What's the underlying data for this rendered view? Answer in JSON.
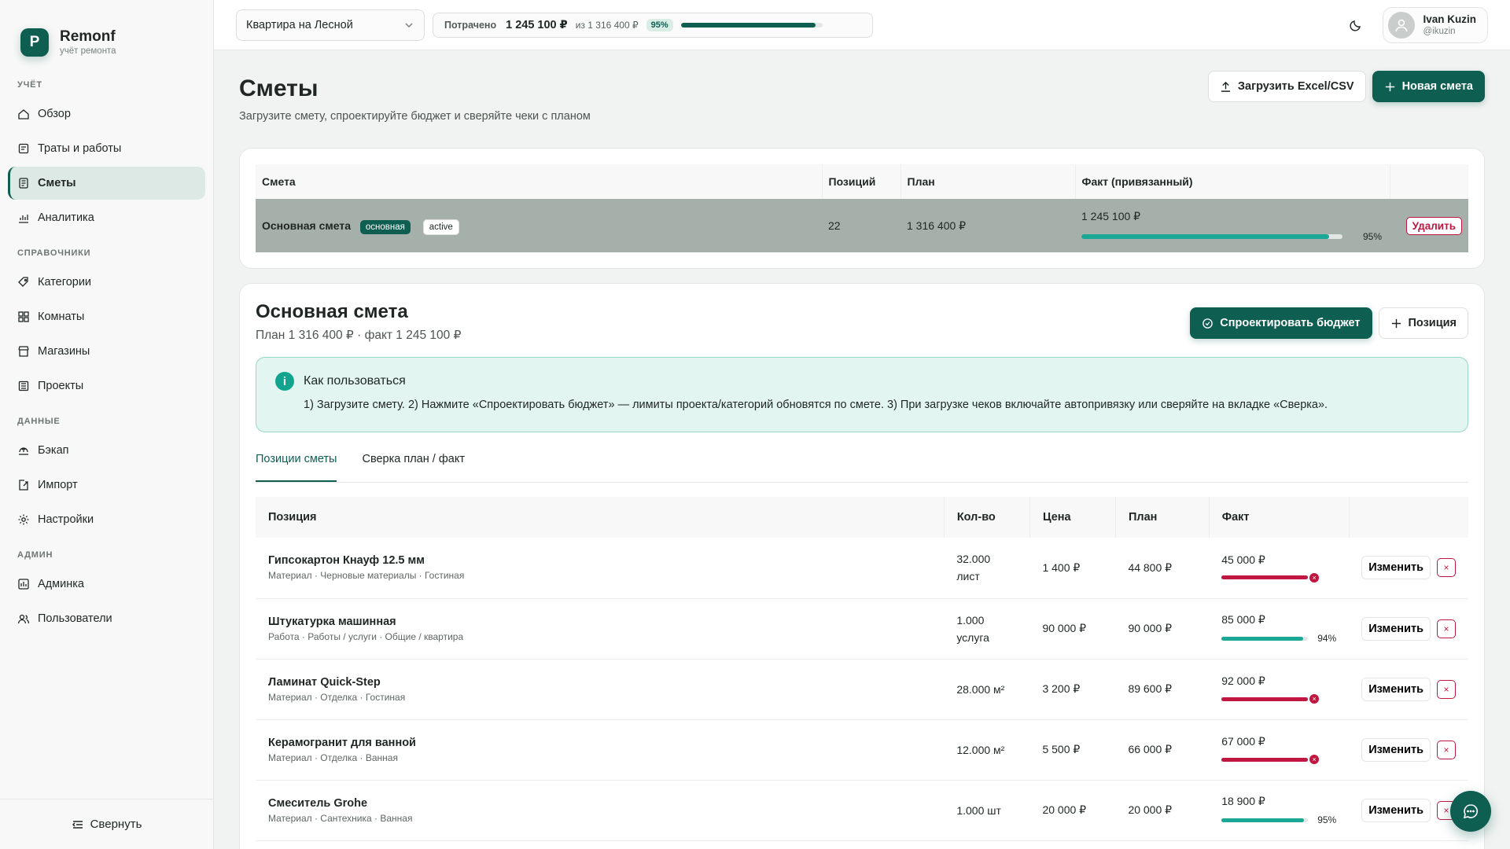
{
  "brand": {
    "letter": "P",
    "name": "Remonf",
    "subtitle": "учёт ремонта"
  },
  "sidebar": {
    "sections": [
      {
        "title": "Учёт",
        "items": [
          {
            "label": "Обзор",
            "icon": "home-icon"
          },
          {
            "label": "Траты и работы",
            "icon": "receipt-icon"
          },
          {
            "label": "Сметы",
            "icon": "estimate-icon",
            "active": true
          },
          {
            "label": "Аналитика",
            "icon": "chart-icon"
          }
        ]
      },
      {
        "title": "Справочники",
        "items": [
          {
            "label": "Категории",
            "icon": "tag-icon"
          },
          {
            "label": "Комнаты",
            "icon": "grid-icon"
          },
          {
            "label": "Магазины",
            "icon": "store-icon"
          },
          {
            "label": "Проекты",
            "icon": "project-icon"
          }
        ]
      },
      {
        "title": "Данные",
        "items": [
          {
            "label": "Бэкап",
            "icon": "backup-icon"
          },
          {
            "label": "Импорт",
            "icon": "import-icon"
          },
          {
            "label": "Настройки",
            "icon": "gear-icon"
          }
        ]
      },
      {
        "title": "Админ",
        "items": [
          {
            "label": "Админка",
            "icon": "admin-icon"
          },
          {
            "label": "Пользователи",
            "icon": "users-icon"
          }
        ]
      }
    ],
    "collapse_label": "Свернуть"
  },
  "topbar": {
    "project": "Квартира на Лесной",
    "spent_label": "Потрачено",
    "spent_value": "1 245 100 ₽",
    "spent_of": "из 1 316 400 ₽",
    "spent_pct": "95%",
    "spent_fraction": 0.95,
    "user_name": "Ivan Kuzin",
    "user_handle": "@ikuzin"
  },
  "page": {
    "title": "Сметы",
    "subtitle": "Загрузите смету, спроектируйте бюджет и сверяйте чеки с планом",
    "upload_label": "Загрузить Excel/CSV",
    "new_label": "Новая смета"
  },
  "estimates": {
    "headers": [
      "Смета",
      "Позиций",
      "План",
      "Факт (привязанный)"
    ],
    "row": {
      "name": "Основная смета",
      "tag_main": "основная",
      "tag_status": "active",
      "positions": "22",
      "plan": "1 316 400 ₽",
      "fact": "1 245 100 ₽",
      "pct": "95%",
      "fraction": 0.95,
      "delete_label": "Удалить"
    }
  },
  "detail": {
    "title": "Основная смета",
    "subtitle": "План 1 316 400 ₽ · факт 1 245 100 ₽",
    "design_label": "Спроектировать бюджет",
    "add_label": "Позиция",
    "info_title": "Как пользоваться",
    "info_text": "1) Загрузите смету. 2) Нажмите «Спроектировать бюджет» — лимиты проекта/категорий обновятся по смете. 3) При загрузке чеков включайте автопривязку или сверяйте на вкладке «Сверка».",
    "tabs": [
      "Позиции сметы",
      "Сверка план / факт"
    ],
    "headers": [
      "Позиция",
      "Кол-во",
      "Цена",
      "План",
      "Факт"
    ],
    "edit_label": "Изменить",
    "remove_label": "×",
    "items": [
      {
        "name": "Гипсокартон Кнауф 12.5 мм",
        "meta": "Материал · Черновые материалы · Гостиная",
        "qty": "32.000",
        "unit": "лист",
        "price": "1 400 ₽",
        "plan": "44 800 ₽",
        "fact": "45 000 ₽",
        "fraction": 1.0,
        "over": true,
        "pct": ""
      },
      {
        "name": "Штукатурка машинная",
        "meta": "Работа · Работы / услуги · Общие / квартира",
        "qty": "1.000",
        "unit": "услуга",
        "price": "90 000 ₽",
        "plan": "90 000 ₽",
        "fact": "85 000 ₽",
        "fraction": 0.94,
        "over": false,
        "pct": "94%"
      },
      {
        "name": "Ламинат Quick-Step",
        "meta": "Материал · Отделка · Гостиная",
        "qty": "28.000 м²",
        "unit": "",
        "price": "3 200 ₽",
        "plan": "89 600 ₽",
        "fact": "92 000 ₽",
        "fraction": 1.0,
        "over": true,
        "pct": ""
      },
      {
        "name": "Керамогранит для ванной",
        "meta": "Материал · Отделка · Ванная",
        "qty": "12.000 м²",
        "unit": "",
        "price": "5 500 ₽",
        "plan": "66 000 ₽",
        "fact": "67 000 ₽",
        "fraction": 1.0,
        "over": true,
        "pct": ""
      },
      {
        "name": "Смеситель Grohe",
        "meta": "Материал · Сантехника · Ванная",
        "qty": "1.000 шт",
        "unit": "",
        "price": "20 000 ₽",
        "plan": "20 000 ₽",
        "fact": "18 900 ₽",
        "fraction": 0.95,
        "over": false,
        "pct": "95%"
      }
    ]
  },
  "colors": {
    "accent": "#0f5e52",
    "ok": "#1aa796",
    "over": "#c0163f",
    "info_bg": "#e2f5f0"
  }
}
